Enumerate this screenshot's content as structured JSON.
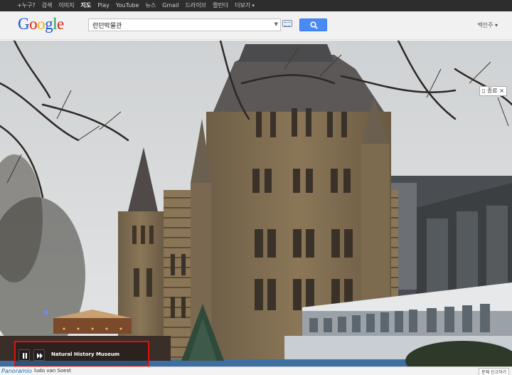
{
  "topbar": {
    "items": [
      {
        "label": "+누구?",
        "active": false
      },
      {
        "label": "검색",
        "active": false
      },
      {
        "label": "이미지",
        "active": false
      },
      {
        "label": "지도",
        "active": true
      },
      {
        "label": "Play",
        "active": false
      },
      {
        "label": "YouTube",
        "active": false
      },
      {
        "label": "뉴스",
        "active": false
      },
      {
        "label": "Gmail",
        "active": false
      },
      {
        "label": "드라이브",
        "active": false
      },
      {
        "label": "캘린더",
        "active": false
      },
      {
        "label": "더보기",
        "active": false
      }
    ]
  },
  "header": {
    "logo_letters": [
      "G",
      "o",
      "o",
      "g",
      "l",
      "e"
    ],
    "search_value": "런던박물관",
    "user_name": "백인주 ▾"
  },
  "viewer": {
    "close_label": "▯ 종료 ×",
    "photo_title": "Natural History Museum"
  },
  "bottom": {
    "brand": "Panoramio",
    "author": "ludo van Soest",
    "report_label": "문제 신고하기"
  },
  "icons": {
    "pause": "pause-icon",
    "next": "fast-forward-icon",
    "search": "magnifier-icon",
    "keyboard": "keyboard-icon",
    "dropdown": "chevron-down-icon"
  },
  "colors": {
    "topbar_bg": "#2d2d2d",
    "search_button": "#4a8af4",
    "highlight_border": "#e01010",
    "panoramio_blue": "#1d6db5"
  }
}
